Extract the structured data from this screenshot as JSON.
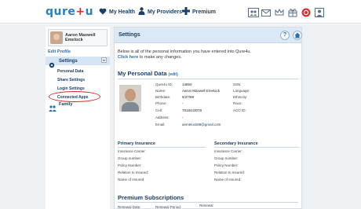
{
  "app": {
    "logo_main": "qure",
    "logo_plus": "+",
    "logo_tail": "u"
  },
  "topnav": {
    "health": "My Health",
    "providers": "My Providers",
    "premium": "Premium"
  },
  "top_icons": [
    "people-icon",
    "mail-icon",
    "crown-icon",
    "gift-icon",
    "gear-icon",
    "profile-icon"
  ],
  "sidebar": {
    "user_name_line1": "Aaron Maxwell",
    "user_name_line2": "Emelock",
    "edit_profile": "Edit Profile",
    "settings_label": "Settings",
    "items": [
      {
        "label": "Personal Data"
      },
      {
        "label": "Share Settings"
      },
      {
        "label": "Login Settings"
      },
      {
        "label": "Connected Apps"
      }
    ],
    "family_label": "Family",
    "highlight_color": "#d22a2a"
  },
  "main": {
    "title": "Settings",
    "intro_line1": "Below is all of the personal information you have entered into Qure4u.",
    "intro_link": "Click here",
    "intro_line2": "to make any changes.",
    "personal_title": "My Personal Data",
    "personal_edit": "(edit)",
    "personal_left_labels": [
      "Qure4u ID:",
      "Name:",
      "Birthdate:",
      "Phone:",
      "Cell:",
      "Address:",
      "Email:"
    ],
    "personal_left_values": [
      "14850",
      "Aaron Maxwell Emelock",
      "9/27/88",
      "-",
      "7818443078",
      "-",
      "aemelock88@gmail.com"
    ],
    "personal_right_labels": [
      "SSN:",
      "Language:",
      "Ethnicity:",
      "Race:",
      "ACO ID:"
    ],
    "primary_title": "Primary Insurance",
    "secondary_title": "Secondary Insurance",
    "insurance_labels": [
      "Insurance Carrier:",
      "Group number:",
      "Policy Number:",
      "Relation to Insured:",
      "Name of Insured:"
    ],
    "premium_title": "Premium Subscriptions",
    "premium_labels": [
      "Renewal Date:",
      "Renewal Period:",
      "Renewal"
    ]
  }
}
